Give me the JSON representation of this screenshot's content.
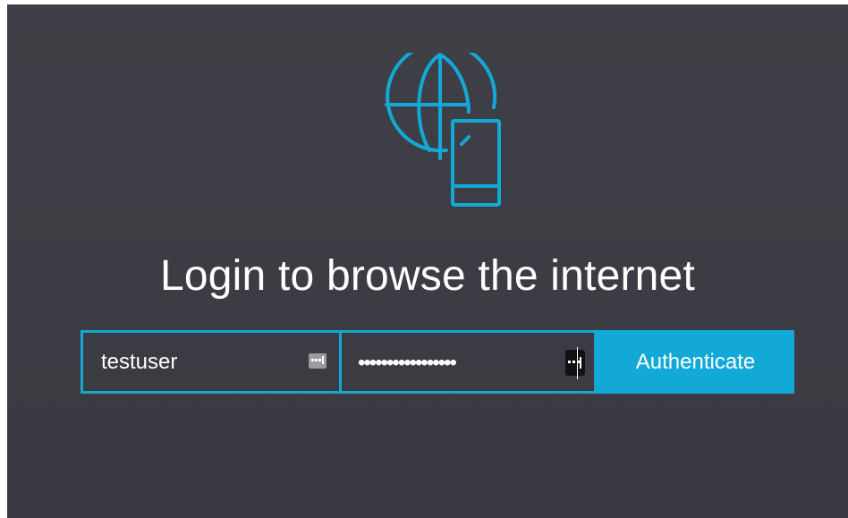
{
  "header": {
    "logo_icon": "globe-phone-icon",
    "title": "Login to browse the internet"
  },
  "form": {
    "username_value": "testuser",
    "password_value": "•••••••••••••••••",
    "password_mask": "•••••••••••••••••",
    "credential_icon": "password-manager-key-icon",
    "authenticate_label": "Authenticate"
  },
  "colors": {
    "background": "#3c3d44",
    "accent": "#13a9d6",
    "text": "#ffffff"
  }
}
